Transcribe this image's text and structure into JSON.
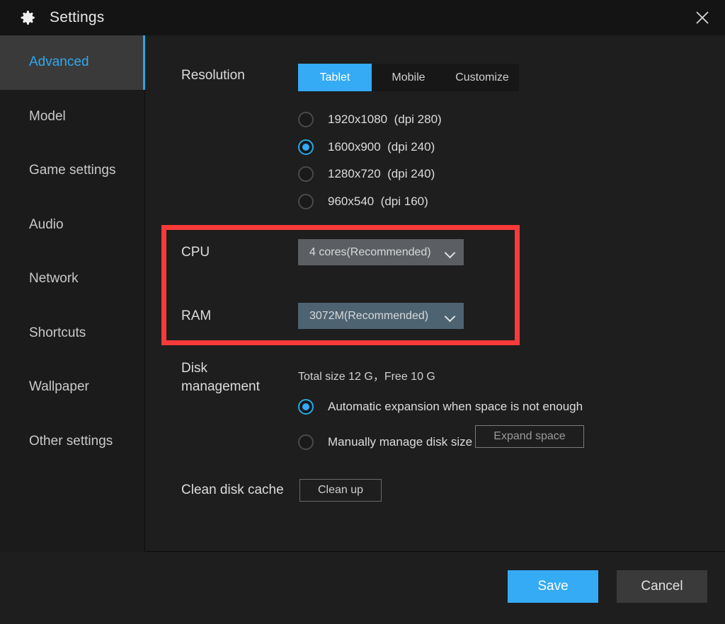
{
  "window": {
    "title": "Settings",
    "gear_icon": "gear-icon",
    "close_icon": "close-icon"
  },
  "sidebar": {
    "items": [
      {
        "label": "Advanced",
        "active": true
      },
      {
        "label": "Model",
        "active": false
      },
      {
        "label": "Game settings",
        "active": false
      },
      {
        "label": "Audio",
        "active": false
      },
      {
        "label": "Network",
        "active": false
      },
      {
        "label": "Shortcuts",
        "active": false
      },
      {
        "label": "Wallpaper",
        "active": false
      },
      {
        "label": "Other settings",
        "active": false
      }
    ]
  },
  "main": {
    "resolution": {
      "label": "Resolution",
      "tabs": [
        {
          "label": "Tablet",
          "active": true
        },
        {
          "label": "Mobile",
          "active": false
        },
        {
          "label": "Customize",
          "active": false
        }
      ],
      "options": [
        {
          "label": "1920x1080  (dpi 280)",
          "selected": false
        },
        {
          "label": "1600x900  (dpi 240)",
          "selected": true
        },
        {
          "label": "1280x720  (dpi 240)",
          "selected": false
        },
        {
          "label": "960x540  (dpi 160)",
          "selected": false
        }
      ]
    },
    "cpu": {
      "label": "CPU",
      "value": "4 cores(Recommended)",
      "chevron_icon": "chevron-down-icon"
    },
    "ram": {
      "label": "RAM",
      "value": "3072M(Recommended)",
      "chevron_icon": "chevron-down-icon"
    },
    "disk": {
      "label_line1": "Disk",
      "label_line2": "management",
      "info": "Total size 12 G，Free 10 G",
      "options": [
        {
          "label": "Automatic expansion when space is not enough",
          "selected": true
        },
        {
          "label": "Manually manage disk size",
          "selected": false
        }
      ],
      "expand_button": "Expand space"
    },
    "clean_cache": {
      "label": "Clean disk cache",
      "button": "Clean up"
    },
    "highlight_color": "#f83a3a"
  },
  "footer": {
    "save_label": "Save",
    "cancel_label": "Cancel",
    "accent_color": "#35aaf5"
  }
}
